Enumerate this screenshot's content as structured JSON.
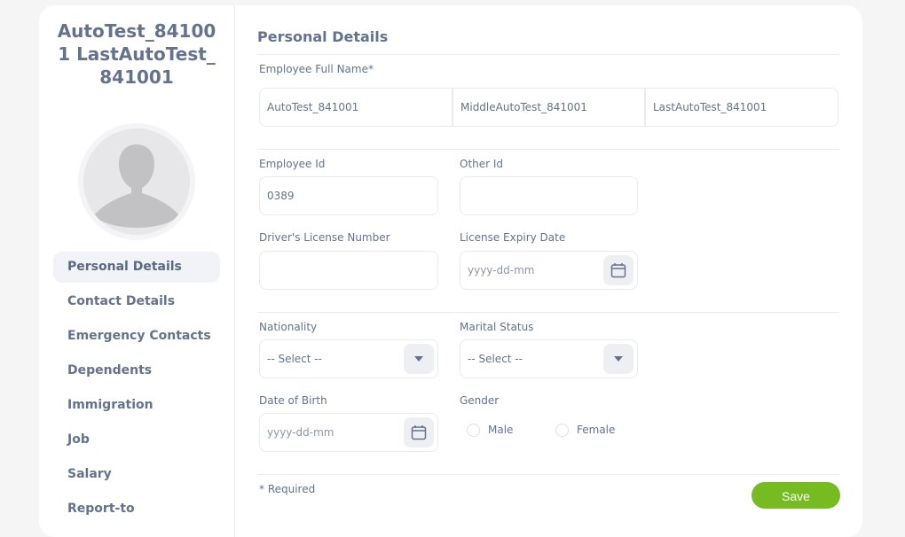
{
  "employee": {
    "name": "AutoTest_841001 LastAutoTest_841001"
  },
  "sidebar": {
    "items": [
      {
        "label": "Personal Details",
        "active": true
      },
      {
        "label": "Contact Details"
      },
      {
        "label": "Emergency Contacts"
      },
      {
        "label": "Dependents"
      },
      {
        "label": "Immigration"
      },
      {
        "label": "Job"
      },
      {
        "label": "Salary"
      },
      {
        "label": "Report-to"
      }
    ]
  },
  "form": {
    "title": "Personal Details",
    "full_name_label": "Employee Full Name*",
    "first_name": "AutoTest_841001",
    "middle_name": "MiddleAutoTest_841001",
    "last_name": "LastAutoTest_841001",
    "employee_id_label": "Employee Id",
    "employee_id": "0389",
    "other_id_label": "Other Id",
    "other_id": "",
    "license_label": "Driver's License Number",
    "license_number": "",
    "license_expiry_label": "License Expiry Date",
    "license_expiry_placeholder": "yyyy-dd-mm",
    "nationality_label": "Nationality",
    "nationality_value": "-- Select --",
    "marital_label": "Marital Status",
    "marital_value": "-- Select --",
    "dob_label": "Date of Birth",
    "dob_placeholder": "yyyy-dd-mm",
    "gender_label": "Gender",
    "gender_male": "Male",
    "gender_female": "Female",
    "required_note": "* Required",
    "save_label": "Save"
  },
  "colors": {
    "accent": "#76bc21",
    "text": "#64728c",
    "border": "#e8eaef"
  },
  "icons": [
    "calendar-icon",
    "caret-down-icon",
    "avatar-silhouette"
  ]
}
